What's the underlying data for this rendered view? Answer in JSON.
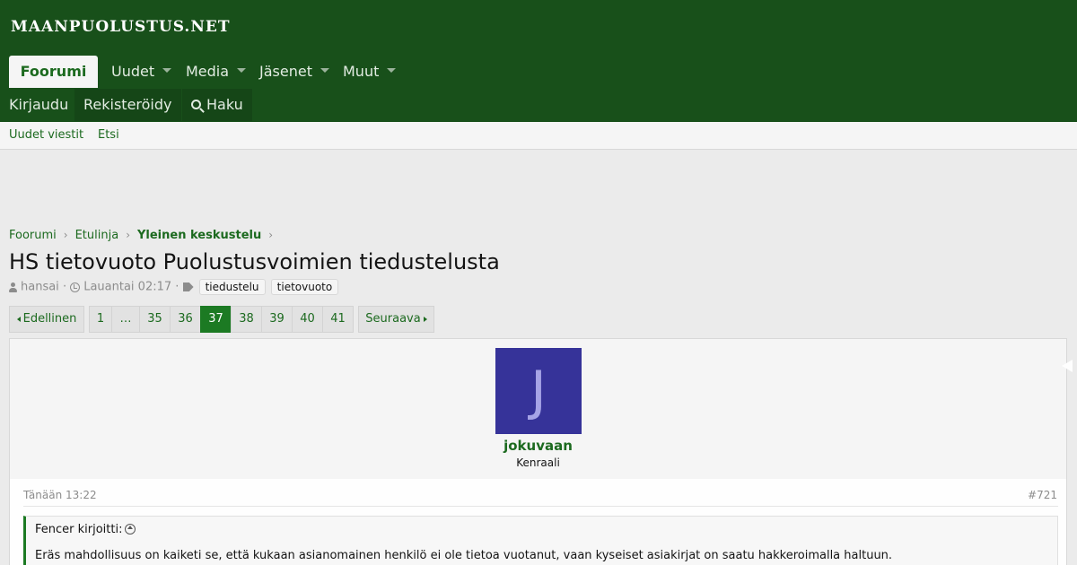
{
  "site": {
    "logo": "MAANPUOLUSTUS.NET"
  },
  "nav": {
    "tabs": [
      {
        "label": "Foorumi"
      },
      {
        "label": "Uudet"
      },
      {
        "label": "Media"
      },
      {
        "label": "Jäsenet"
      },
      {
        "label": "Muut"
      }
    ],
    "login": "Kirjaudu",
    "register": "Rekisteröidy",
    "search": "Haku"
  },
  "subnav": {
    "new_posts": "Uudet viestit",
    "search": "Etsi"
  },
  "breadcrumb": [
    "Foorumi",
    "Etulinja",
    "Yleinen keskustelu"
  ],
  "thread": {
    "title": "HS tietovuoto Puolustusvoimien tiedustelusta",
    "author": "hansai",
    "date": "Lauantai 02:17",
    "tags": [
      "tiedustelu",
      "tietovuoto"
    ]
  },
  "pagination": {
    "prev": "Edellinen",
    "next": "Seuraava",
    "pages": [
      "1",
      "…",
      "35",
      "36",
      "37",
      "38",
      "39",
      "40",
      "41"
    ],
    "current": "37"
  },
  "post": {
    "avatar_letter": "J",
    "username": "jokuvaan",
    "user_title": "Kenraali",
    "date": "Tänään 13:22",
    "number": "#721",
    "quote_author": "Fencer kirjoitti:",
    "quote_text": "Eräs mahdollisuus on kaiketi se, että kukaan asianomainen henkilö ei ole tietoa vuotanut, vaan kyseiset asiakirjat on saatu hakkeroimalla haltuun."
  },
  "colors": {
    "header_bg": "#18501a",
    "accent": "#1c6a1f",
    "avatar_bg": "#363399"
  }
}
